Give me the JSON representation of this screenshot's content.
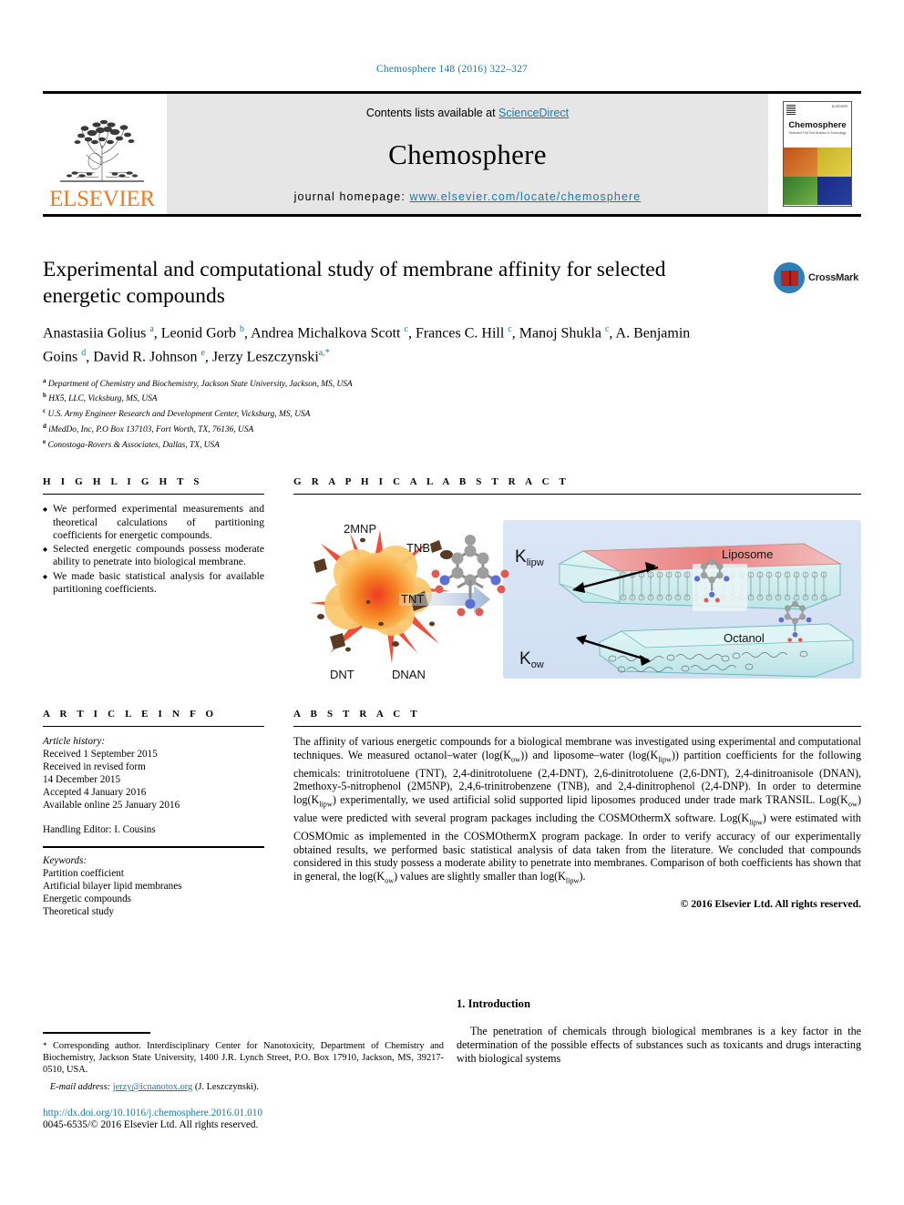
{
  "running_head": "Chemosphere 148 (2016) 322–327",
  "masthead": {
    "publisher": "ELSEVIER",
    "contents_prefix": "Contents lists available at ",
    "contents_link": "ScienceDirect",
    "journal_name": "Chemosphere",
    "homepage_prefix": "journal homepage: ",
    "homepage_url": "www.elsevier.com/locate/chemosphere",
    "cover_title": "Chemosphere",
    "cover_subtitle": "Selected Full-Text Articles in Toxicology",
    "cover_brand": "ELSEVIER",
    "link_color": "#1a7aa8",
    "elsevier_orange": "#F07C22"
  },
  "article": {
    "title": "Experimental and computational study of membrane affinity for selected energetic compounds",
    "authors": "Anastasiia Golius a, Leonid Gorb b, Andrea Michalkova Scott c, Frances C. Hill c, Manoj Shukla c, A. Benjamin Goins d, David R. Johnson e, Jerzy Leszczynski a,*",
    "affiliations": [
      {
        "marker": "a",
        "text": "Department of Chemistry and Biochemistry, Jackson State University, Jackson, MS, USA"
      },
      {
        "marker": "b",
        "text": "HX5, LLC, Vicksburg, MS, USA"
      },
      {
        "marker": "c",
        "text": "U.S. Army Engineer Research and Development Center, Vicksburg, MS, USA"
      },
      {
        "marker": "d",
        "text": "iMedDo, Inc, P.O Box 137103, Fort Worth, TX, 76136, USA"
      },
      {
        "marker": "e",
        "text": "Conostoga-Rovers & Associates, Dallas, TX, USA"
      }
    ],
    "crossmark_label": "CrossMark"
  },
  "highlights": {
    "heading": "H I G H L I G H T S",
    "items": [
      "We performed experimental measurements and theoretical calculations of partitioning coefficients for energetic compounds.",
      "Selected energetic compounds possess moderate ability to penetrate into biological membrane.",
      "We made basic statistical analysis for available partitioning coefficients."
    ]
  },
  "graphical_abstract": {
    "heading": "G R A P H I C A L   A B S T R A C T",
    "labels": {
      "explosive_top_left": "2MNP",
      "explosive_top_right": "TNB",
      "explosive_center": "TNT",
      "explosive_bottom_left": "DNT",
      "explosive_bottom_right": "DNAN",
      "liposome": "Liposome",
      "octanol": "Octanol",
      "k_lipw": "K",
      "k_lipw_sub": "lipw",
      "k_ow": "K",
      "k_ow_sub": "ow"
    }
  },
  "article_info": {
    "heading": "A R T I C L E   I N F O",
    "history_label": "Article history:",
    "history": [
      "Received 1 September 2015",
      "Received in revised form",
      "14 December 2015",
      "Accepted 4 January 2016",
      "Available online 25 January 2016"
    ],
    "handling_editor": "Handling Editor: I. Cousins",
    "keywords_label": "Keywords:",
    "keywords": [
      "Partition coefficient",
      "Artificial bilayer lipid membranes",
      "Energetic compounds",
      "Theoretical study"
    ]
  },
  "abstract": {
    "heading": "A B S T R A C T",
    "p1_a": "The affinity of various energetic compounds for a biological membrane was investigated using experimental and computational techniques. We measured octanol–water (log(K",
    "p1_b": "ow",
    "p1_c": ")) and liposome–water (log(K",
    "p1_d": "lipw",
    "p1_e": ")) partition coefficients for the following chemicals: trinitrotoluene (TNT), 2,4-dinitrotoluene (2,4-DNT), 2,6-dinitrotoluene (2,6-DNT), 2,4-dinitroanisole (DNAN), 2methoxy-5-nitrophenol (2M5NP), 2,4,6-trinitrobenzene (TNB), and 2,4-dinitrophenol (2,4-DNP). In order to determine log(K",
    "p1_f": "lipw",
    "p1_g": ") experimentally, we used artificial solid supported lipid liposomes produced under trade mark TRANSIL. Log(K",
    "p1_h": "ow",
    "p1_i": ") value were predicted with several program packages including the COSMOthermX software. Log(K",
    "p1_j": "lipw",
    "p1_k": ") were estimated with COSMOmic as implemented in the COSMOthermX program package. In order to verify accuracy of our experimentally obtained results, we performed basic statistical analysis of data taken from the literature. We concluded that compounds considered in this study possess a moderate ability to penetrate into membranes. Comparison of both coefficients has shown that in general, the log(K",
    "p1_l": "ow",
    "p1_m": ") values are slightly smaller than log(K",
    "p1_n": "lipw",
    "p1_o": ").",
    "copyright": "© 2016 Elsevier Ltd. All rights reserved."
  },
  "footer": {
    "corresponding": "Corresponding author. Interdisciplinary Center for Nanotoxicity, Department of Chemistry and Biochemistry, Jackson State University, 1400 J.R. Lynch Street, P.O. Box 17910, Jackson, MS, 39217-0510, USA.",
    "email_label": "E-mail address:",
    "email": "jerzy@icnanotox.org",
    "email_owner": "(J. Leszczynski).",
    "doi": "http://dx.doi.org/10.1016/j.chemosphere.2016.01.010",
    "issn": "0045-6535/© 2016 Elsevier Ltd. All rights reserved."
  },
  "introduction": {
    "heading": "1. Introduction",
    "paragraph": "The penetration of chemicals through biological membranes is a key factor in the determination of the possible effects of substances such as toxicants and drugs interacting with biological systems"
  }
}
